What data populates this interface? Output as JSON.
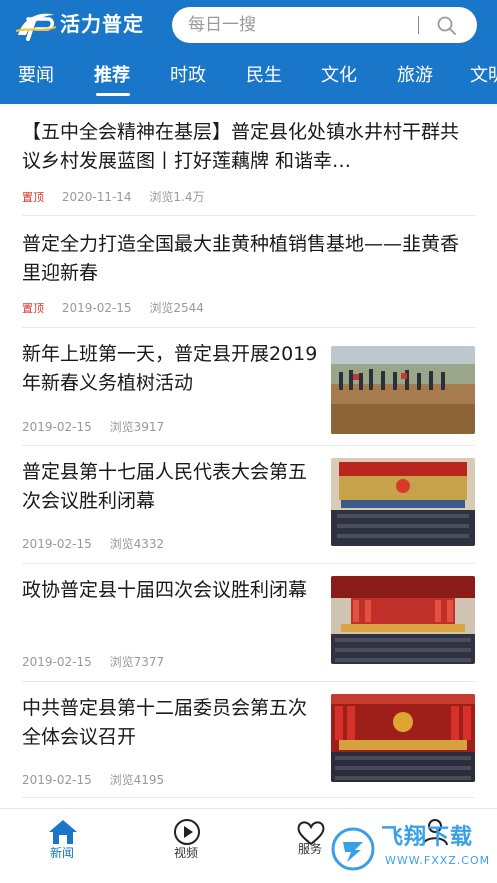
{
  "header": {
    "brand": "活力普定",
    "search_placeholder": "每日一搜",
    "accent_color": "#1976c9",
    "logo_icon": "app-logo-icon",
    "search_icon": "search-icon"
  },
  "tabs": [
    {
      "label": "要闻",
      "active": false
    },
    {
      "label": "推荐",
      "active": true
    },
    {
      "label": "时政",
      "active": false
    },
    {
      "label": "民生",
      "active": false
    },
    {
      "label": "文化",
      "active": false
    },
    {
      "label": "旅游",
      "active": false
    },
    {
      "label": "文明",
      "active": false
    }
  ],
  "feed": {
    "items": [
      {
        "title": "【五中全会精神在基层】普定县化处镇水井村干群共议乡村发展蓝图丨打好莲藕牌 和谐幸…",
        "pinned_label": "置顶",
        "date": "2020-11-14",
        "views": "浏览1.4万"
      },
      {
        "title": "普定全力打造全国最大韭黄种植销售基地——韭黄香里迎新春",
        "pinned_label": "置顶",
        "date": "2019-02-15",
        "views": "浏览2544"
      },
      {
        "title": "新年上班第一天，普定县开展2019年新春义务植树活动",
        "date": "2019-02-15",
        "views": "浏览3917"
      },
      {
        "title": "普定县第十七届人民代表大会第五次会议胜利闭幕",
        "date": "2019-02-15",
        "views": "浏览4332"
      },
      {
        "title": "政协普定县十届四次会议胜利闭幕",
        "date": "2019-02-15",
        "views": "浏览7377"
      },
      {
        "title": "中共普定县第十二届委员会第五次全体会议召开",
        "date": "2019-02-15",
        "views": "浏览4195"
      }
    ]
  },
  "tabbar": {
    "items": [
      {
        "label": "新闻",
        "icon": "home-icon",
        "active": true
      },
      {
        "label": "视频",
        "icon": "play-icon",
        "active": false
      },
      {
        "label": "服务",
        "icon": "heart-icon",
        "active": false
      },
      {
        "label": "",
        "icon": "user-icon",
        "active": false
      }
    ]
  },
  "watermark": {
    "text": "飞翔下载",
    "url": "WWW.FXXZ.COM"
  }
}
